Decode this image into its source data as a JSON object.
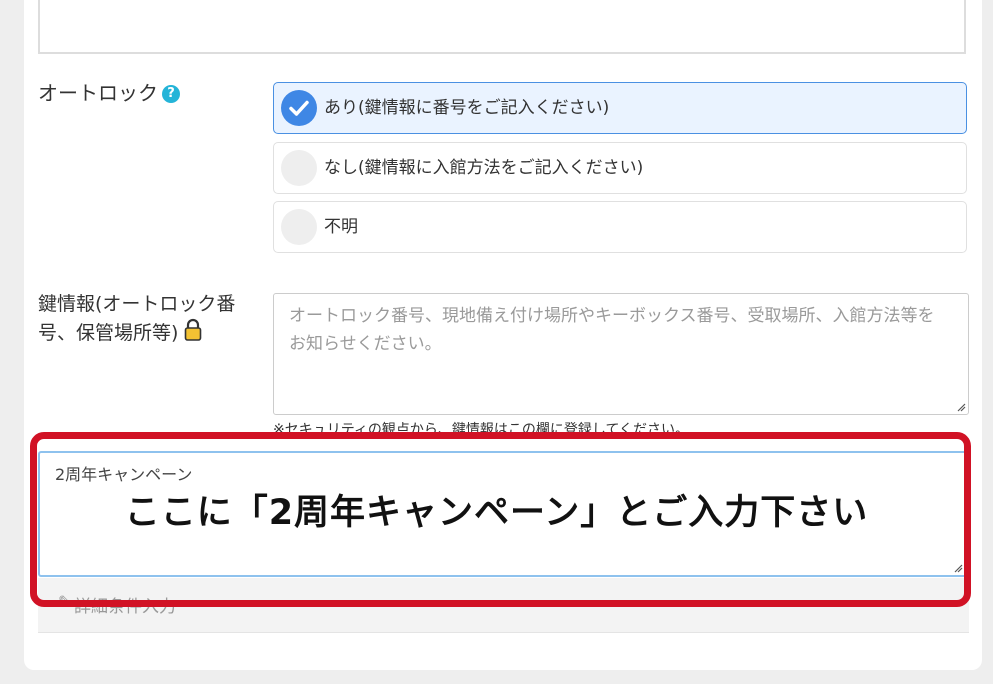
{
  "autolock": {
    "label": "オートロック",
    "help_icon": "question-circle-icon",
    "options": [
      {
        "label": "あり(鍵情報に番号をご記入ください)",
        "selected": true
      },
      {
        "label": "なし(鍵情報に入館方法をご記入ください)",
        "selected": false
      },
      {
        "label": "不明",
        "selected": false
      }
    ]
  },
  "key_info": {
    "label_line1": "鍵情報(オートロック番",
    "label_line2": "号、保管場所等)",
    "lock_icon": "padlock-icon",
    "placeholder": "オートロック番号、現地備え付け場所やキーボックス番号、受取場所、入館方法等をお知らせください。",
    "note": "※セキュリティの観点から、鍵情報はこの欄に登録してください。"
  },
  "campaign_field": {
    "value": "2周年キャンペーン"
  },
  "instruction_overlay": "ここに「2周年キャンペーン」とご入力下さい",
  "detail_link": {
    "icon": "pencil-icon",
    "label": "詳細条件入力"
  },
  "colors": {
    "accent": "#3f87e5",
    "highlight": "#d11225",
    "help": "#24b4d8"
  }
}
